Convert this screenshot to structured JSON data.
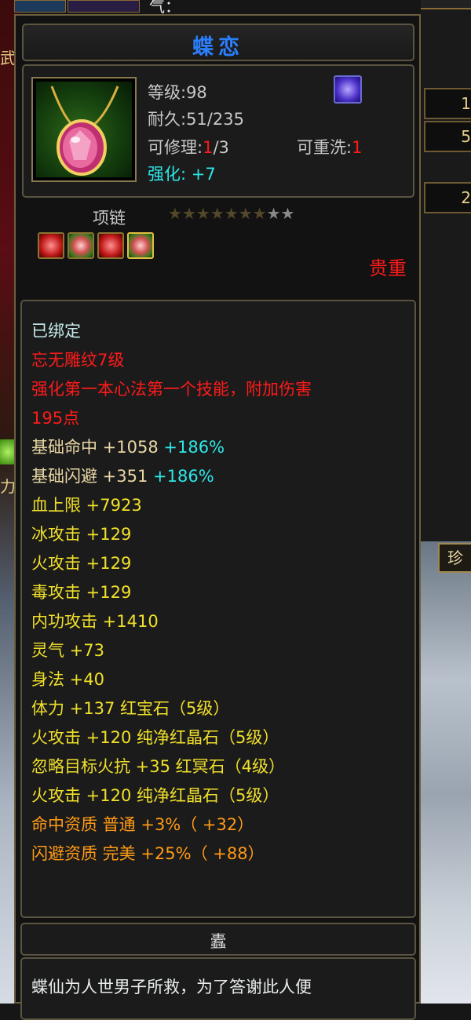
{
  "scene": {
    "side_left_labels": [
      "武",
      "力"
    ],
    "side_right_numbers": [
      "1",
      "5",
      "2"
    ],
    "rare_tab_label": "珍",
    "top_text": "气："
  },
  "item": {
    "name": "蝶恋",
    "level": "等级:98",
    "durability": "耐久:51/235",
    "repairable_label": "可修理:",
    "repairable_current": "1",
    "repairable_total": "/3",
    "rewash_label": "可重洗:",
    "rewash_value": "1",
    "enhance_label": "强化: ",
    "enhance_value": "+7",
    "type": "项链",
    "stars_total": 9,
    "stars_lit": 2,
    "sockets": [
      "red-gem",
      "watermelon-gem",
      "red-gem",
      "watermelon-gem-selected"
    ],
    "rarity": "贵重"
  },
  "attributes": {
    "bound": "已绑定",
    "engrave": "忘无雕纹7级",
    "skill_line1": "强化第一本心法第一个技能，附加伤害",
    "skill_line2": "195点",
    "hit_label": "基础命中 +1058 ",
    "hit_pct": "+186%",
    "dodge_label": "基础闪避 +351 ",
    "dodge_pct": "+186%",
    "hp": "血上限 +7923",
    "ice": "冰攻击 +129",
    "fire": "火攻击 +129",
    "poison": "毒攻击 +129",
    "inner": "内功攻击 +1410",
    "spirit": "灵气 +73",
    "agility": "身法 +40",
    "gem1": "体力 +137 红宝石（5级）",
    "gem2": "火攻击 +120 纯净红晶石（5级）",
    "gem3": "忽略目标火抗 +35 红冥石（4级）",
    "gem4": "火攻击 +120 纯净红晶石（5级）",
    "aptitude1": "命中资质  普通 +3%（ +32）",
    "aptitude2": "闪避资质  完美 +25%（ +88）"
  },
  "description": {
    "title": "蠹",
    "text": "蝶仙为人世男子所救，为了答谢此人便"
  }
}
